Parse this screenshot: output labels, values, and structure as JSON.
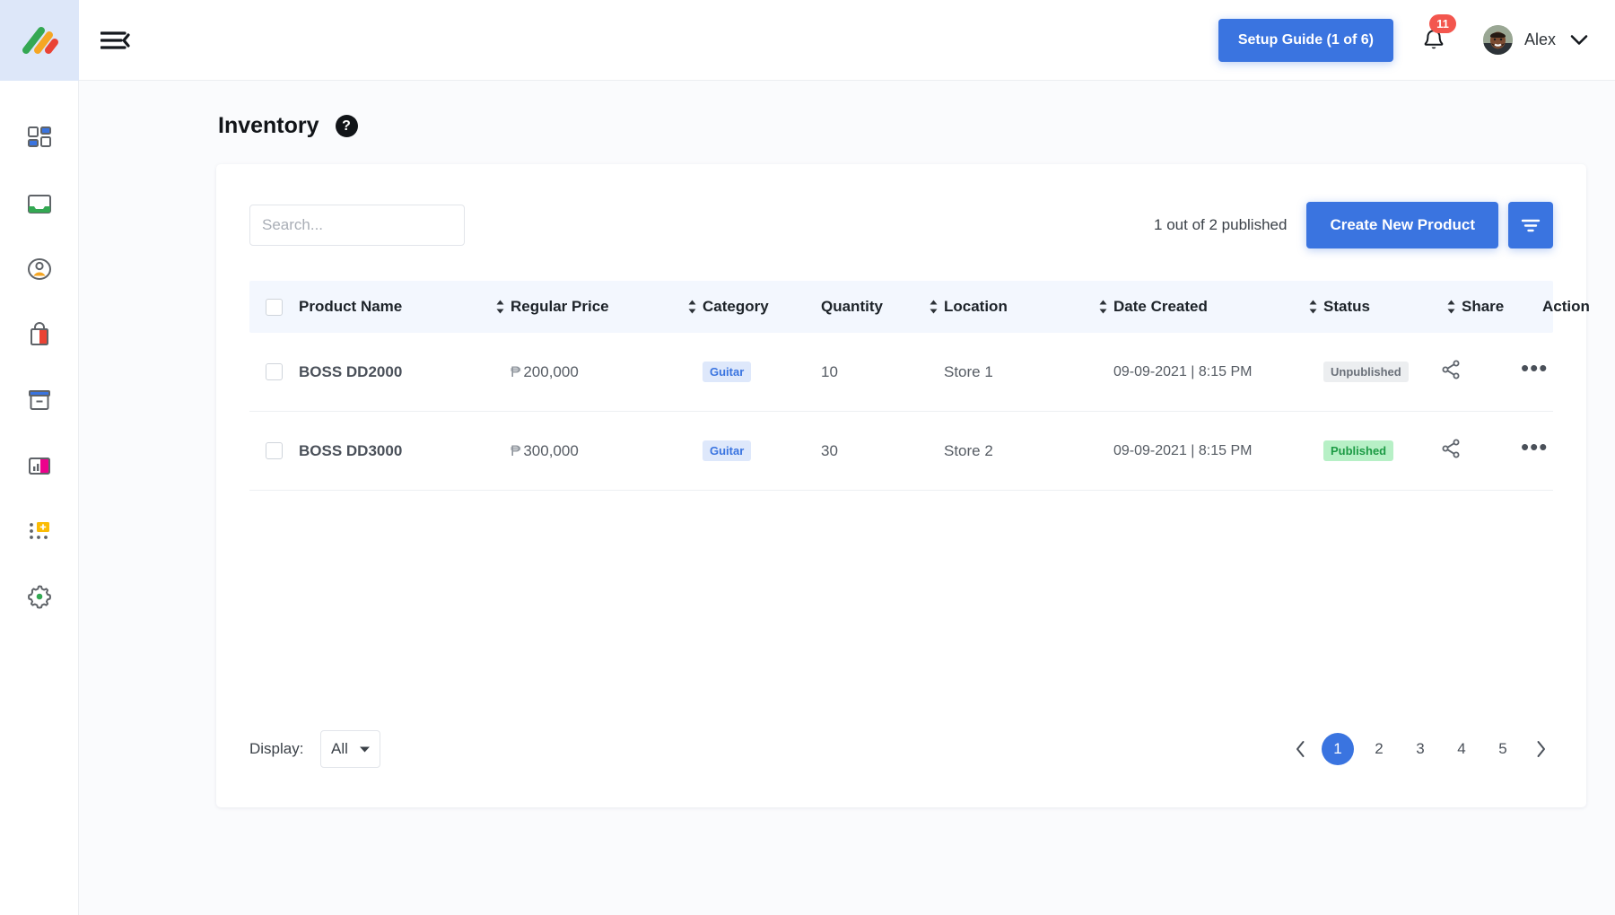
{
  "brand": {
    "logo_name": "mono-logo",
    "logo_colors": [
      "#34a853",
      "#f5a623",
      "#ea4335"
    ],
    "accent": "#3a74e0"
  },
  "topbar": {
    "menu_icon": "hamburger-collapse-icon",
    "setup_guide_label": "Setup Guide (1 of 6)",
    "notification_icon": "bell-icon",
    "notification_count": "11",
    "user_name": "Alex",
    "caret_icon": "chevron-down-icon"
  },
  "sidebar": {
    "items": [
      {
        "name": "dashboard",
        "icon": "dashboard-grid-icon"
      },
      {
        "name": "inbox",
        "icon": "inbox-tray-icon"
      },
      {
        "name": "customers",
        "icon": "user-circle-icon"
      },
      {
        "name": "shop",
        "icon": "shopping-bag-icon"
      },
      {
        "name": "inventory",
        "icon": "archive-box-icon"
      },
      {
        "name": "reports",
        "icon": "bar-chart-icon"
      },
      {
        "name": "apps",
        "icon": "apps-add-icon"
      },
      {
        "name": "settings",
        "icon": "gear-icon"
      }
    ]
  },
  "page": {
    "title": "Inventory",
    "help_icon": "question-mark-icon"
  },
  "toolbar": {
    "search_placeholder": "Search...",
    "search_value": "",
    "search_icon": "search-icon",
    "published_summary": "1 out of 2 published",
    "create_label": "Create New Product",
    "filter_icon": "filter-icon"
  },
  "table": {
    "select_all_checked": false,
    "columns": [
      {
        "label": "Product Name",
        "sortable": true
      },
      {
        "label": "Regular Price",
        "sortable": true
      },
      {
        "label": "Category",
        "sortable": false
      },
      {
        "label": "Quantity",
        "sortable": true
      },
      {
        "label": "Location",
        "sortable": true
      },
      {
        "label": "Date Created",
        "sortable": true
      },
      {
        "label": "Status",
        "sortable": true
      },
      {
        "label": "Share",
        "sortable": false
      },
      {
        "label": "Action",
        "sortable": false
      }
    ],
    "rows": [
      {
        "checked": false,
        "product_name": "BOSS DD2000",
        "currency": "₱",
        "price": "200,000",
        "category": "Guitar",
        "quantity": "10",
        "location": "Store 1",
        "date_created": "09-09-2021 | 8:15 PM",
        "status": "Unpublished",
        "status_type": "unpublished",
        "share_icon": "share-icon",
        "action_icon": "more-horizontal-icon"
      },
      {
        "checked": false,
        "product_name": "BOSS DD3000",
        "currency": "₱",
        "price": "300,000",
        "category": "Guitar",
        "quantity": "30",
        "location": "Store 2",
        "date_created": "09-09-2021 | 8:15 PM",
        "status": "Published",
        "status_type": "published",
        "share_icon": "share-icon",
        "action_icon": "more-horizontal-icon"
      }
    ]
  },
  "footer": {
    "display_label": "Display:",
    "display_value": "All",
    "display_caret_icon": "caret-down-icon",
    "prev_icon": "chevron-left-icon",
    "next_icon": "chevron-right-icon",
    "pages": [
      "1",
      "2",
      "3",
      "4",
      "5"
    ],
    "active_page": "1"
  },
  "colors": {
    "badge_category_bg": "#dee8fb",
    "badge_category_text": "#3a74e0",
    "badge_published_bg": "#b7f0c6",
    "badge_published_text": "#1d9b45",
    "badge_unpublished_bg": "#eceef0",
    "badge_unpublished_text": "#6a7079",
    "notification_badge": "#f3564e",
    "table_header_bg": "#f3f7fe"
  }
}
